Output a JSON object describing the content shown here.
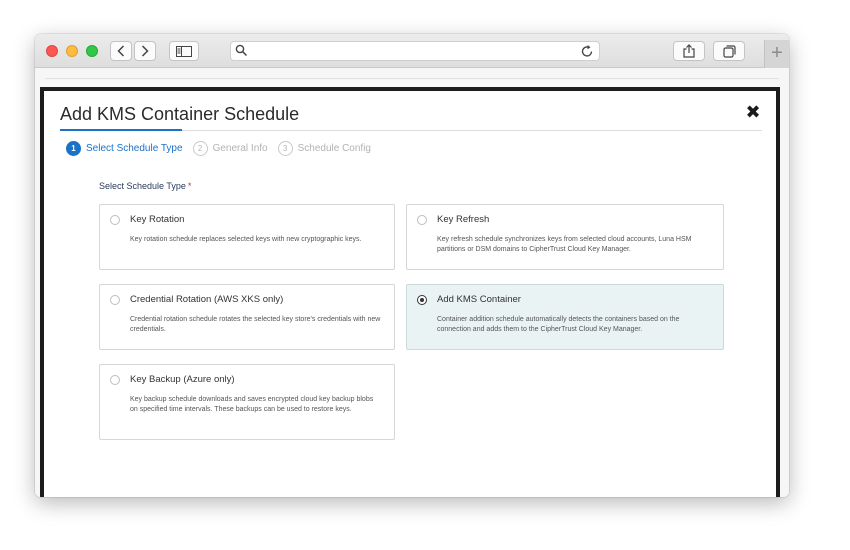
{
  "modal": {
    "title": "Add KMS Container Schedule",
    "close_glyph": "✖"
  },
  "steps": [
    {
      "number": "1",
      "label": "Select Schedule Type",
      "active": true
    },
    {
      "number": "2",
      "label": "General Info",
      "active": false
    },
    {
      "number": "3",
      "label": "Schedule Config",
      "active": false
    }
  ],
  "section": {
    "label": "Select Schedule Type",
    "required_mark": "*"
  },
  "options": [
    {
      "title": "Key Rotation",
      "description": "Key rotation schedule replaces selected keys with new cryptographic keys.",
      "selected": false
    },
    {
      "title": "Key Refresh",
      "description": "Key refresh schedule synchronizes keys from selected cloud accounts, Luna HSM partitions or DSM domains to CipherTrust Cloud Key Manager.",
      "selected": false
    },
    {
      "title": "Credential Rotation (AWS XKS only)",
      "description": "Credential rotation schedule rotates the selected key store's credentials with new credentials.",
      "selected": false
    },
    {
      "title": "Add KMS Container",
      "description": "Container addition schedule automatically detects the containers based on the connection and adds them to the CipherTrust Cloud Key Manager.",
      "selected": true
    },
    {
      "title": "Key Backup (Azure only)",
      "description": "Key backup schedule downloads and saves encrypted cloud key backup blobs on specified time intervals. These backups can be used to restore keys.",
      "selected": false
    }
  ],
  "browser": {
    "new_tab_glyph": "+"
  },
  "colors": {
    "accent": "#1a73c7",
    "required": "#d32f2f",
    "selected_card_bg": "#eaf3f3"
  }
}
